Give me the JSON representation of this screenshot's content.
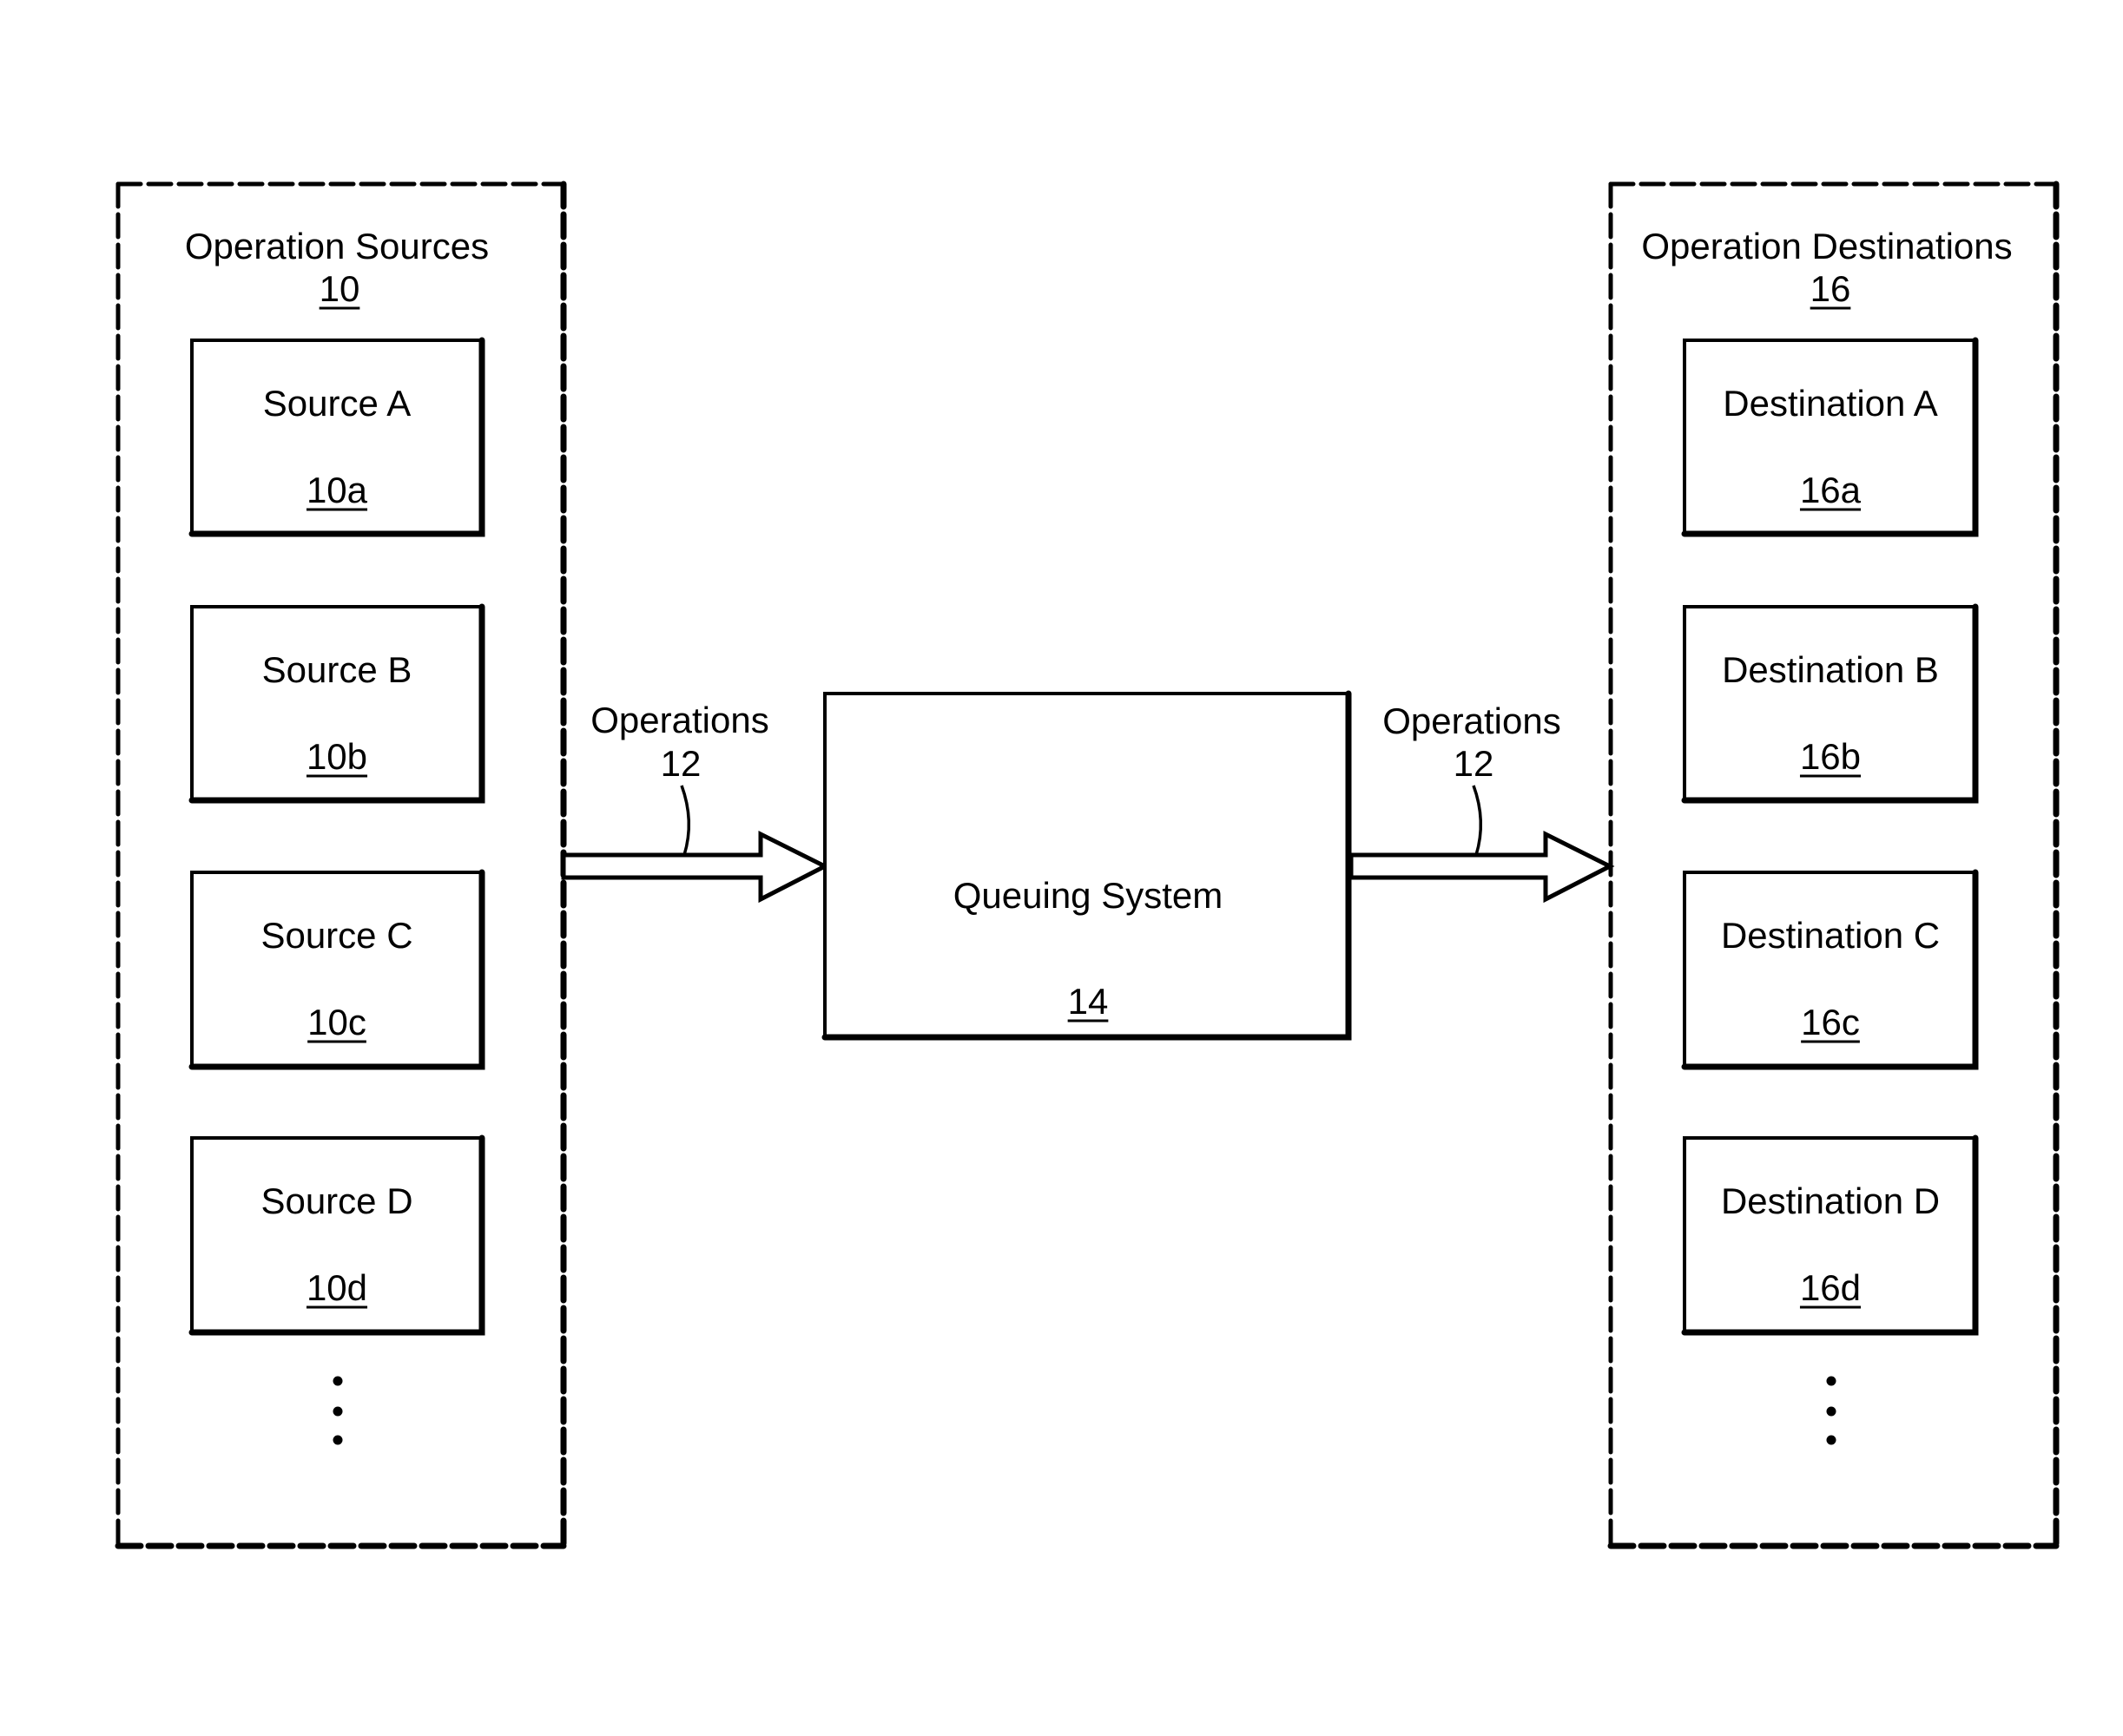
{
  "sources_group": {
    "title": "Operation Sources",
    "ref": "10",
    "items": [
      {
        "label": "Source A",
        "ref": "10a"
      },
      {
        "label": "Source B",
        "ref": "10b"
      },
      {
        "label": "Source C",
        "ref": "10c"
      },
      {
        "label": "Source D",
        "ref": "10d"
      }
    ],
    "continuation": "more-items-ellipsis"
  },
  "queuing_system": {
    "label": "Queuing System",
    "ref": "14"
  },
  "incoming_arrow": {
    "label": "Operations",
    "ref": "12"
  },
  "outgoing_arrow": {
    "label": "Operations",
    "ref": "12"
  },
  "destinations_group": {
    "title": "Operation Destinations",
    "ref": "16",
    "items": [
      {
        "label": "Destination A",
        "ref": "16a"
      },
      {
        "label": "Destination B",
        "ref": "16b"
      },
      {
        "label": "Destination C",
        "ref": "16c"
      },
      {
        "label": "Destination D",
        "ref": "16d"
      }
    ],
    "continuation": "more-items-ellipsis"
  },
  "colors": {
    "line": "#000000",
    "background": "#ffffff"
  }
}
